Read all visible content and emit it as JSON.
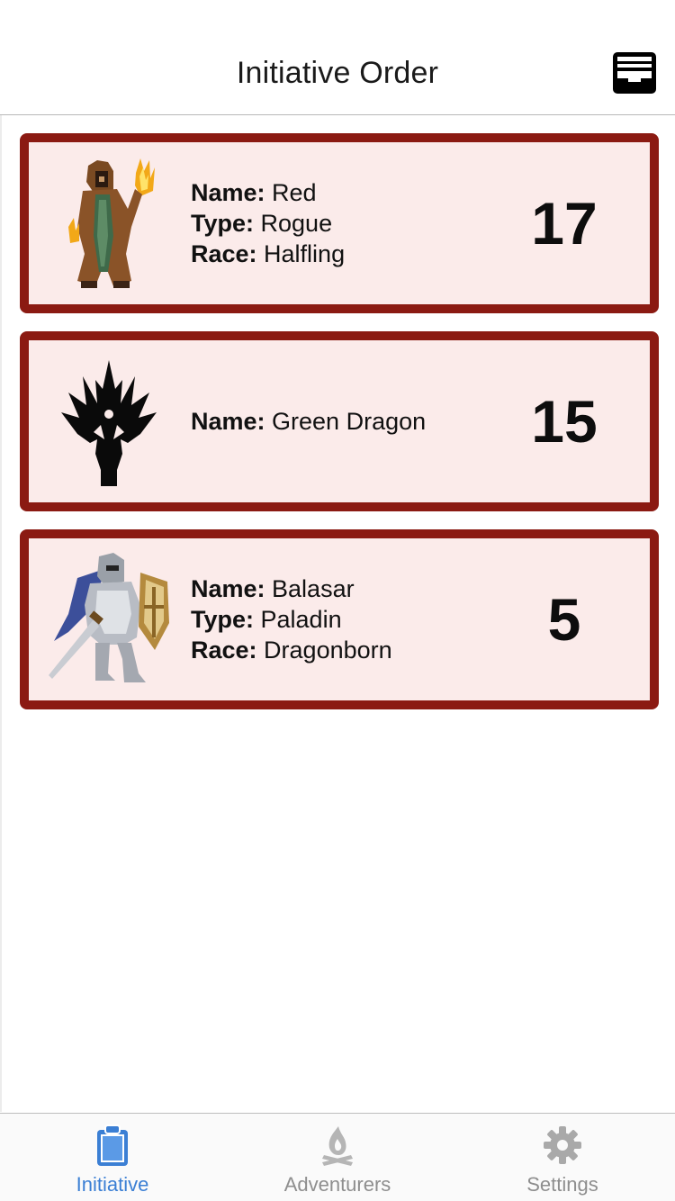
{
  "header": {
    "title": "Initiative Order",
    "action_icon": "inbox-tray-icon"
  },
  "combatants": [
    {
      "name_label": "Name:",
      "name": "Red",
      "type_label": "Type:",
      "type": "Rogue",
      "race_label": "Race:",
      "race": "Halfling",
      "initiative": "17",
      "avatar_icon": "hooded-rogue-sprite"
    },
    {
      "name_label": "Name:",
      "name": "Green Dragon",
      "initiative": "15",
      "avatar_icon": "dragon-emblem-icon"
    },
    {
      "name_label": "Name:",
      "name": "Balasar",
      "type_label": "Type:",
      "type": "Paladin",
      "race_label": "Race:",
      "race": "Dragonborn",
      "initiative": "5",
      "avatar_icon": "armored-paladin-sprite"
    }
  ],
  "tabs": [
    {
      "label": "Initiative",
      "icon": "clipboard-icon",
      "active": true
    },
    {
      "label": "Adventurers",
      "icon": "campfire-icon",
      "active": false
    },
    {
      "label": "Settings",
      "icon": "gear-icon",
      "active": false
    }
  ],
  "colors": {
    "card_border": "#8b1a12",
    "card_background": "#fbebea",
    "tab_active": "#3b7fd4",
    "tab_inactive": "#8e8e8e"
  }
}
